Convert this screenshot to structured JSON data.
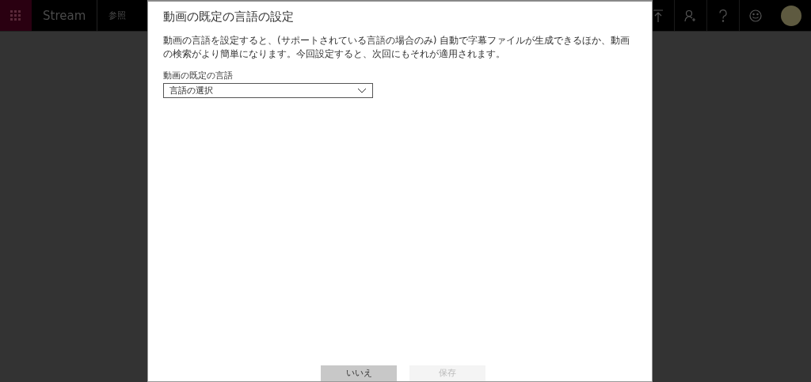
{
  "top_bar": {
    "app_name": "Stream",
    "nav_items": [
      {
        "label": "参照"
      }
    ]
  },
  "dialog": {
    "title": "動画の既定の言語の設定",
    "description": "動画の言語を設定すると、(サポートされている言語の場合のみ) 自動で字幕ファイルが生成できるほか、動画の検索がより簡単になります。今回設定すると、次回にもそれが適用されます。",
    "field_label": "動画の既定の言語",
    "select": {
      "value": "言語の選択"
    },
    "buttons": [
      {
        "label": "いいえ",
        "disabled": false
      },
      {
        "label": "保存",
        "disabled": true
      }
    ]
  }
}
